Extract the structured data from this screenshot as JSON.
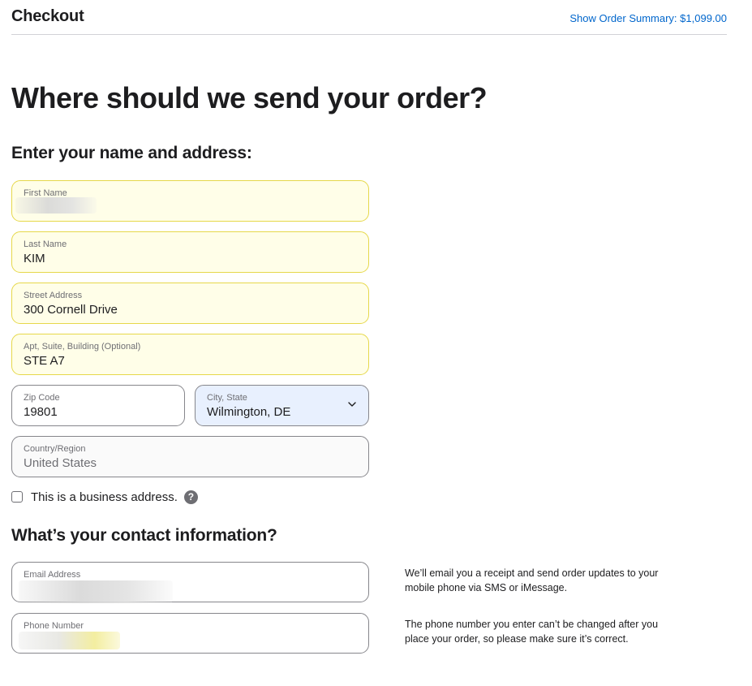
{
  "header": {
    "title": "Checkout",
    "order_summary_link": "Show Order Summary: $1,099.00"
  },
  "main": {
    "heading": "Where should we send your order?",
    "address_section": {
      "heading": "Enter your name and address:",
      "fields": {
        "first_name": {
          "label": "First Name",
          "value": ""
        },
        "last_name": {
          "label": "Last Name",
          "value": "KIM"
        },
        "street": {
          "label": "Street Address",
          "value": "300 Cornell Drive"
        },
        "apt": {
          "label": "Apt, Suite, Building (Optional)",
          "value": "STE A7"
        },
        "zip": {
          "label": "Zip Code",
          "value": "19801"
        },
        "city_state": {
          "label": "City, State",
          "value": "Wilmington, DE"
        },
        "country": {
          "label": "Country/Region",
          "value": "United States"
        }
      },
      "business_checkbox": {
        "label": "This is a business address.",
        "checked": false,
        "help_icon": "?"
      }
    },
    "contact_section": {
      "heading": "What’s your contact information?",
      "fields": {
        "email": {
          "label": "Email Address",
          "value": ""
        },
        "phone": {
          "label": "Phone Number",
          "value": ""
        }
      },
      "notes": {
        "email_note": "We’ll email you a receipt and send order updates to your mobile phone via SMS or iMessage.",
        "phone_note": "The phone number you enter can’t be changed after you place your order, so please make sure it’s correct."
      }
    }
  },
  "colors": {
    "link": "#0066cc",
    "autofill_bg": "#fffee8",
    "select_bg": "#e8f0fe",
    "text": "#1d1d1f"
  }
}
